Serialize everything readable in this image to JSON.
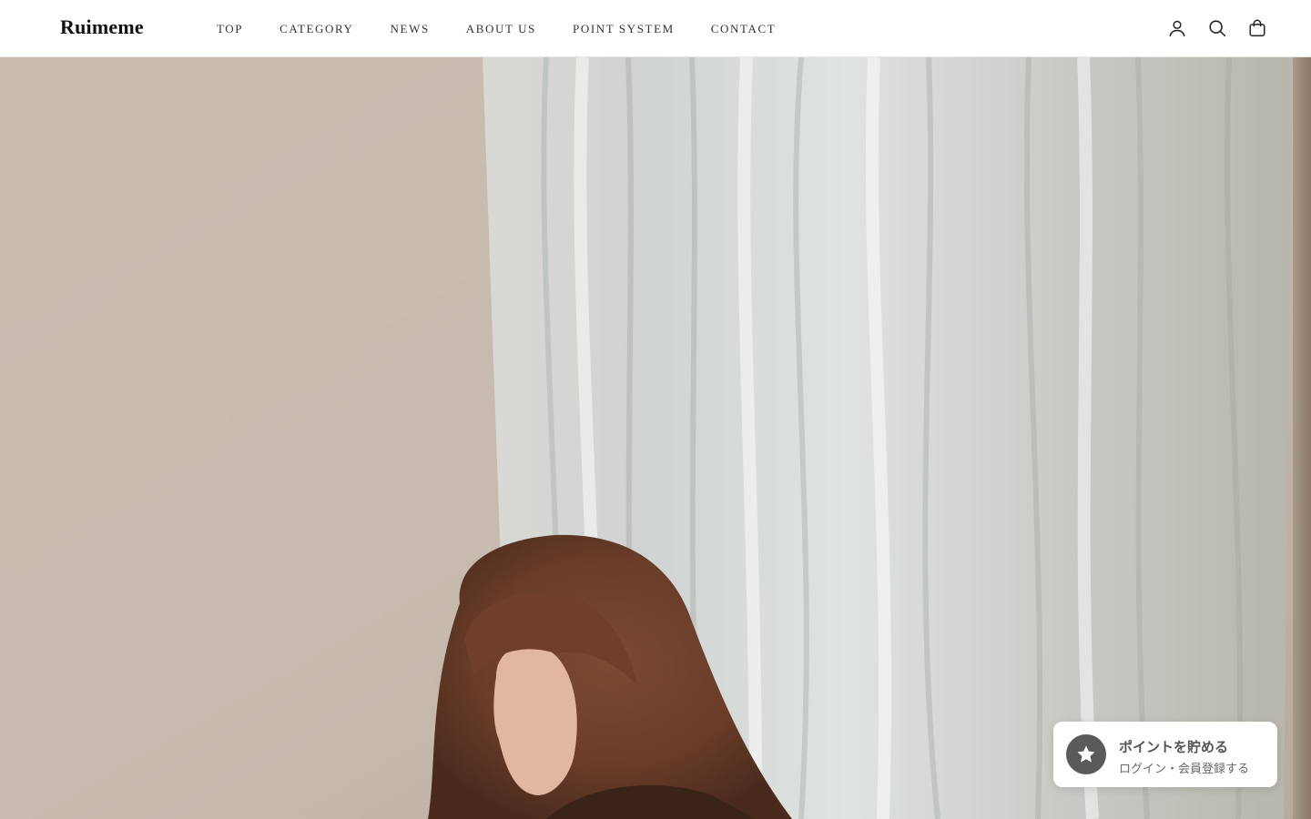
{
  "brand": {
    "logo_text": "Ruimeme"
  },
  "nav": {
    "items": [
      {
        "label": "TOP"
      },
      {
        "label": "CATEGORY"
      },
      {
        "label": "NEWS"
      },
      {
        "label": "ABOUT US"
      },
      {
        "label": "POINT SYSTEM"
      },
      {
        "label": "CONTACT"
      }
    ]
  },
  "header_icons": [
    "account-icon",
    "search-icon",
    "cart-icon"
  ],
  "hero": {
    "image_alt": ""
  },
  "points_widget": {
    "title": "ポイントを貯める",
    "subtitle": "ログイン・会員登録する",
    "icon": "star-icon",
    "badge_color": "#5a5a5a"
  }
}
